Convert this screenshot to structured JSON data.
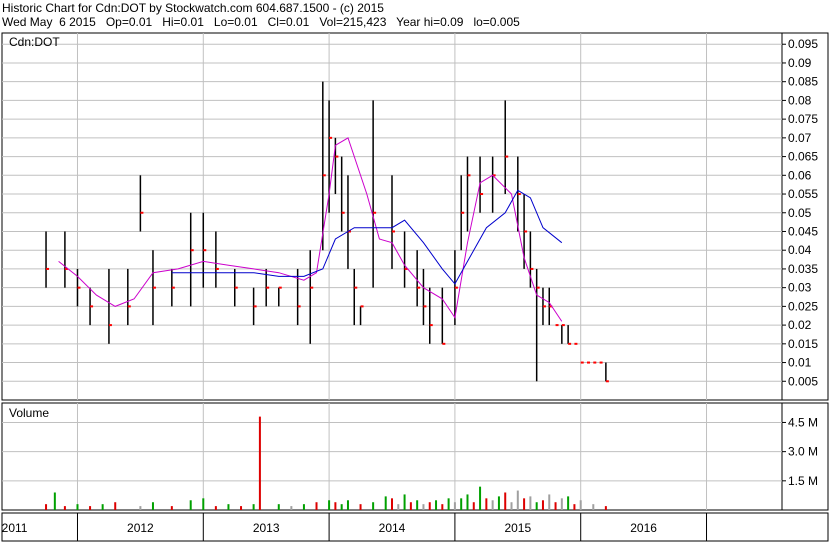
{
  "header": {
    "line1": "Historic Chart for Cdn:DOT by Stockwatch.com 604.687.1500 - (c) 2015",
    "line2": "Wed May  6 2015   Op=0.01   Hi=0.01   Lo=0.01   Cl=0.01   Vol=215,423   Year hi=0.09   lo=0.005"
  },
  "colors": {
    "price_bar": "#000000",
    "close_tick": "#ff0000",
    "ma_short": "#cc00cc",
    "ma_long": "#0000cc",
    "vol_up": "#00a000",
    "vol_down": "#dd0000",
    "vol_flat": "#a0a0a0",
    "grid": "#c0c0c0",
    "border": "#000000"
  },
  "chart_data": [
    {
      "type": "line",
      "title": "Cdn:DOT",
      "ylim": [
        0,
        0.098
      ],
      "y_ticks": [
        "0.005",
        "0.01",
        "0.015",
        "0.02",
        "0.025",
        "0.03",
        "0.035",
        "0.04",
        "0.045",
        "0.05",
        "0.055",
        "0.06",
        "0.065",
        "0.07",
        "0.075",
        "0.08",
        "0.085",
        "0.09",
        "0.095"
      ],
      "x_ticks": [
        "2011",
        "2012",
        "2013",
        "2014",
        "2015",
        "2016"
      ],
      "grid": true,
      "ohlc_sample": {
        "x": [
          2010.75,
          2010.9,
          2011.0,
          2011.1,
          2011.25,
          2011.4,
          2011.5,
          2011.6,
          2011.75,
          2011.9,
          2012.0,
          2012.1,
          2012.25,
          2012.4,
          2012.5,
          2012.6,
          2012.75,
          2012.85,
          2012.95,
          2013.0,
          2013.05,
          2013.1,
          2013.15,
          2013.2,
          2013.25,
          2013.35,
          2013.5,
          2013.6,
          2013.7,
          2013.75,
          2013.8,
          2013.9,
          2014.0,
          2014.05,
          2014.1,
          2014.2,
          2014.3,
          2014.4,
          2014.5,
          2014.55,
          2014.6,
          2014.65,
          2014.7,
          2014.75,
          2014.8,
          2014.85,
          2014.9,
          2014.95,
          2015.0,
          2015.05,
          2015.1,
          2015.15,
          2015.2
        ],
        "high": [
          0.045,
          0.045,
          0.035,
          0.03,
          0.035,
          0.035,
          0.06,
          0.04,
          0.035,
          0.05,
          0.05,
          0.045,
          0.035,
          0.03,
          0.035,
          0.03,
          0.035,
          0.04,
          0.085,
          0.08,
          0.07,
          0.065,
          0.06,
          0.035,
          0.025,
          0.08,
          0.06,
          0.045,
          0.04,
          0.035,
          0.03,
          0.03,
          0.04,
          0.06,
          0.065,
          0.065,
          0.065,
          0.08,
          0.065,
          0.055,
          0.045,
          0.035,
          0.03,
          0.03,
          0.02,
          0.02,
          0.02,
          0.015,
          0.01,
          0.01,
          0.01,
          0.01,
          0.01
        ],
        "low": [
          0.03,
          0.03,
          0.025,
          0.02,
          0.015,
          0.02,
          0.045,
          0.02,
          0.025,
          0.025,
          0.03,
          0.03,
          0.025,
          0.02,
          0.025,
          0.025,
          0.02,
          0.015,
          0.04,
          0.05,
          0.055,
          0.045,
          0.035,
          0.02,
          0.02,
          0.03,
          0.035,
          0.03,
          0.025,
          0.02,
          0.015,
          0.015,
          0.02,
          0.04,
          0.045,
          0.05,
          0.05,
          0.055,
          0.045,
          0.035,
          0.03,
          0.005,
          0.02,
          0.02,
          0.02,
          0.015,
          0.015,
          0.015,
          0.01,
          0.01,
          0.01,
          0.01,
          0.005
        ],
        "close": [
          0.035,
          0.035,
          0.03,
          0.025,
          0.02,
          0.025,
          0.05,
          0.03,
          0.03,
          0.04,
          0.04,
          0.035,
          0.03,
          0.025,
          0.03,
          0.03,
          0.025,
          0.03,
          0.06,
          0.07,
          0.065,
          0.05,
          0.045,
          0.03,
          0.025,
          0.05,
          0.045,
          0.035,
          0.03,
          0.025,
          0.02,
          0.015,
          0.03,
          0.05,
          0.06,
          0.055,
          0.06,
          0.065,
          0.055,
          0.045,
          0.035,
          0.03,
          0.025,
          0.025,
          0.02,
          0.02,
          0.015,
          0.015,
          0.01,
          0.01,
          0.01,
          0.01,
          0.005
        ]
      },
      "series": [
        {
          "color": "#cc00cc",
          "x": [
            2010.85,
            2011.0,
            2011.15,
            2011.3,
            2011.45,
            2011.6,
            2011.8,
            2012.0,
            2012.2,
            2012.4,
            2012.6,
            2012.8,
            2012.9,
            2013.0,
            2013.05,
            2013.15,
            2013.3,
            2013.4,
            2013.5,
            2013.6,
            2013.75,
            2013.9,
            2014.0,
            2014.1,
            2014.2,
            2014.3,
            2014.45,
            2014.55,
            2014.65,
            2014.75,
            2014.85
          ],
          "y": [
            0.037,
            0.033,
            0.028,
            0.025,
            0.027,
            0.034,
            0.035,
            0.037,
            0.036,
            0.035,
            0.034,
            0.032,
            0.034,
            0.055,
            0.068,
            0.07,
            0.055,
            0.043,
            0.042,
            0.036,
            0.03,
            0.027,
            0.022,
            0.042,
            0.058,
            0.06,
            0.055,
            0.038,
            0.028,
            0.026,
            0.021
          ]
        },
        {
          "color": "#0000cc",
          "x": [
            2011.75,
            2012.0,
            2012.2,
            2012.4,
            2012.6,
            2012.8,
            2012.95,
            2013.05,
            2013.2,
            2013.35,
            2013.5,
            2013.6,
            2013.75,
            2013.9,
            2014.0,
            2014.1,
            2014.25,
            2014.4,
            2014.5,
            2014.6,
            2014.7,
            2014.85
          ],
          "y": [
            0.034,
            0.034,
            0.034,
            0.034,
            0.033,
            0.033,
            0.035,
            0.043,
            0.046,
            0.046,
            0.046,
            0.048,
            0.042,
            0.035,
            0.031,
            0.037,
            0.046,
            0.05,
            0.056,
            0.054,
            0.046,
            0.042
          ]
        }
      ]
    },
    {
      "type": "bar",
      "title": "Volume",
      "y_ticks": [
        "1.5 M",
        "3.0 M",
        "4.5 M"
      ],
      "ylim": [
        0,
        5.5
      ],
      "bars": {
        "x": [
          2010.75,
          2010.82,
          2010.9,
          2011.0,
          2011.1,
          2011.2,
          2011.3,
          2011.5,
          2011.6,
          2011.75,
          2011.9,
          2012.0,
          2012.1,
          2012.2,
          2012.3,
          2012.4,
          2012.45,
          2012.6,
          2012.7,
          2012.8,
          2012.9,
          2013.0,
          2013.05,
          2013.1,
          2013.15,
          2013.25,
          2013.35,
          2013.45,
          2013.5,
          2013.55,
          2013.6,
          2013.65,
          2013.7,
          2013.75,
          2013.8,
          2013.85,
          2013.9,
          2013.95,
          2014.0,
          2014.05,
          2014.1,
          2014.15,
          2014.2,
          2014.25,
          2014.3,
          2014.35,
          2014.4,
          2014.45,
          2014.5,
          2014.55,
          2014.6,
          2014.65,
          2014.7,
          2014.75,
          2014.8,
          2014.85,
          2014.9,
          2014.95,
          2015.0,
          2015.1,
          2015.2
        ],
        "y": [
          0.3,
          0.9,
          0.2,
          0.3,
          0.2,
          0.3,
          0.4,
          0.2,
          0.4,
          0.2,
          0.5,
          0.6,
          0.2,
          0.3,
          0.2,
          0.3,
          4.8,
          0.3,
          0.2,
          0.3,
          0.4,
          0.5,
          0.4,
          0.3,
          0.5,
          0.3,
          0.4,
          0.7,
          0.6,
          0.3,
          0.8,
          0.4,
          0.5,
          0.3,
          0.4,
          0.5,
          0.3,
          0.6,
          0.4,
          0.6,
          0.8,
          0.4,
          1.2,
          0.6,
          0.5,
          0.7,
          0.9,
          0.4,
          1.0,
          0.6,
          0.7,
          0.4,
          0.5,
          0.8,
          0.4,
          0.6,
          0.7,
          0.3,
          0.5,
          0.3,
          0.2
        ],
        "dir": [
          "d",
          "u",
          "d",
          "u",
          "d",
          "u",
          "d",
          "f",
          "u",
          "d",
          "u",
          "u",
          "d",
          "u",
          "d",
          "u",
          "d",
          "u",
          "f",
          "u",
          "d",
          "u",
          "d",
          "u",
          "u",
          "d",
          "u",
          "u",
          "d",
          "f",
          "u",
          "d",
          "u",
          "f",
          "d",
          "u",
          "d",
          "u",
          "f",
          "u",
          "u",
          "d",
          "u",
          "d",
          "f",
          "u",
          "d",
          "f",
          "f",
          "d",
          "f",
          "u",
          "d",
          "f",
          "d",
          "f",
          "u",
          "d",
          "f",
          "f",
          "d"
        ]
      }
    }
  ]
}
